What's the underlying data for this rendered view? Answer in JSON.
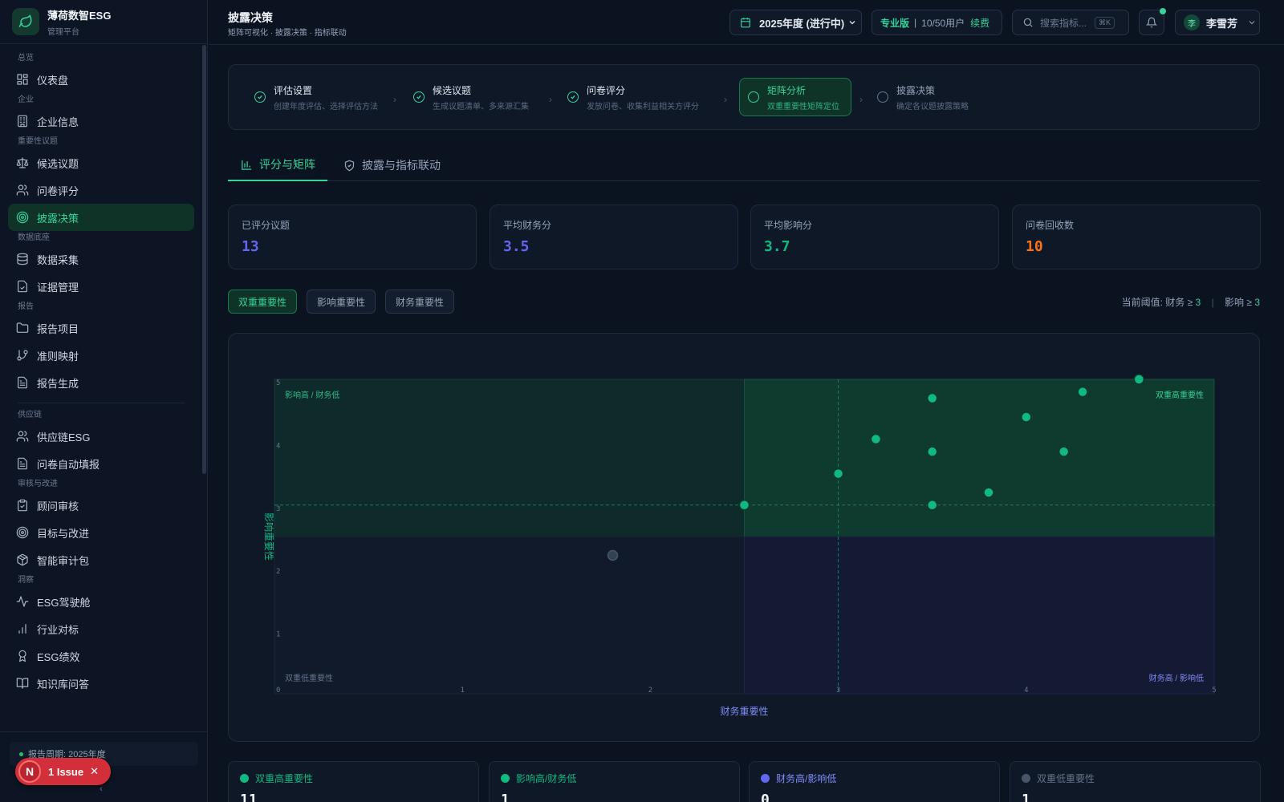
{
  "brand": {
    "name": "薄荷数智ESG",
    "sub": "管理平台"
  },
  "sidebar": {
    "groups": [
      {
        "label": "总览",
        "items": [
          {
            "label": "仪表盘",
            "icon": "grid-icon"
          }
        ]
      },
      {
        "label": "企业",
        "items": [
          {
            "label": "企业信息",
            "icon": "building-icon"
          }
        ]
      },
      {
        "label": "重要性议题",
        "items": [
          {
            "label": "候选议题",
            "icon": "scale-icon"
          },
          {
            "label": "问卷评分",
            "icon": "users-icon"
          },
          {
            "label": "披露决策",
            "icon": "target-icon",
            "active": true
          }
        ]
      },
      {
        "label": "数据底座",
        "items": [
          {
            "label": "数据采集",
            "icon": "database-icon"
          },
          {
            "label": "证据管理",
            "icon": "file-check-icon"
          }
        ]
      },
      {
        "label": "报告",
        "items": [
          {
            "label": "报告项目",
            "icon": "folder-icon"
          },
          {
            "label": "准则映射",
            "icon": "git-branch-icon"
          },
          {
            "label": "报告生成",
            "icon": "file-text-icon"
          }
        ]
      },
      {
        "label": "供应链",
        "divider": true,
        "items": [
          {
            "label": "供应链ESG",
            "icon": "users-icon"
          },
          {
            "label": "问卷自动填报",
            "icon": "file-text-icon"
          }
        ]
      },
      {
        "label": "审核与改进",
        "items": [
          {
            "label": "顾问审核",
            "icon": "clipboard-check-icon"
          },
          {
            "label": "目标与改进",
            "icon": "target-icon"
          },
          {
            "label": "智能审计包",
            "icon": "package-icon"
          }
        ]
      },
      {
        "label": "洞察",
        "items": [
          {
            "label": "ESG驾驶舱",
            "icon": "activity-icon"
          },
          {
            "label": "行业对标",
            "icon": "bar-chart-icon"
          },
          {
            "label": "ESG绩效",
            "icon": "award-icon"
          },
          {
            "label": "知识库问答",
            "icon": "book-icon"
          }
        ]
      }
    ],
    "period": "报告周期: 2025年度",
    "collapse": "‹"
  },
  "issue": {
    "letter": "N",
    "label": "1 Issue",
    "close": "✕"
  },
  "header": {
    "title": "披露决策",
    "subtitle": "矩阵可视化 · 披露决策 · 指标联动",
    "year": "2025年度 (进行中)",
    "plan": {
      "name": "专业版",
      "sep": "|",
      "users": "10/50用户",
      "renew": "续费"
    },
    "search_placeholder": "搜索指标...",
    "search_kbd": "⌘K",
    "user_avatar": "李",
    "user_name": "李雪芳"
  },
  "steps": [
    {
      "title": "评估设置",
      "desc": "创建年度评估、选择评估方法",
      "state": "done"
    },
    {
      "title": "候选议题",
      "desc": "生成议题清单、多来源汇集",
      "state": "done"
    },
    {
      "title": "问卷评分",
      "desc": "发放问卷、收集利益相关方评分",
      "state": "done"
    },
    {
      "title": "矩阵分析",
      "desc": "双重重要性矩阵定位",
      "state": "active"
    },
    {
      "title": "披露决策",
      "desc": "确定各议题披露策略",
      "state": "pending"
    }
  ],
  "tabs": [
    {
      "label": "评分与矩阵",
      "icon": "bar-chart-icon",
      "active": true
    },
    {
      "label": "披露与指标联动",
      "icon": "shield-check-icon",
      "active": false
    }
  ],
  "stats": [
    {
      "label": "已评分议题",
      "value": "13",
      "color": "#6366f1"
    },
    {
      "label": "平均财务分",
      "value": "3.5",
      "color": "#6366f1"
    },
    {
      "label": "平均影响分",
      "value": "3.7",
      "color": "#10b981"
    },
    {
      "label": "问卷回收数",
      "value": "10",
      "color": "#f97316"
    }
  ],
  "filters": [
    {
      "label": "双重重要性",
      "active": true
    },
    {
      "label": "影响重要性",
      "active": false
    },
    {
      "label": "财务重要性",
      "active": false
    }
  ],
  "threshold": {
    "prefix": "当前阈值: 财务 ≥",
    "financial": "3",
    "sep": "|",
    "impact_prefix": "影响 ≥",
    "impact": "3"
  },
  "chart_data": {
    "type": "scatter",
    "xlabel": "财务重要性",
    "ylabel": "影响重要性",
    "xlim": [
      0,
      5
    ],
    "ylim": [
      0,
      5
    ],
    "x_ticks": [
      "0",
      "1",
      "2",
      "3",
      "4",
      "5"
    ],
    "y_ticks": [
      "1",
      "2",
      "3",
      "4",
      "5"
    ],
    "threshold_x": 3,
    "threshold_y": 3,
    "quadrants": {
      "top_left": "影响高 / 财务低",
      "top_right": "双重高重要性",
      "bottom_left": "双重低重要性",
      "bottom_right": "财务高 / 影响低"
    },
    "points": [
      {
        "x": 2.5,
        "y": 3.0
      },
      {
        "x": 1.8,
        "y": 2.2
      },
      {
        "x": 3.0,
        "y": 3.5
      },
      {
        "x": 3.2,
        "y": 4.05
      },
      {
        "x": 3.5,
        "y": 4.7
      },
      {
        "x": 3.5,
        "y": 3.85
      },
      {
        "x": 3.5,
        "y": 3.0
      },
      {
        "x": 3.8,
        "y": 3.2
      },
      {
        "x": 4.0,
        "y": 4.4
      },
      {
        "x": 4.2,
        "y": 3.85
      },
      {
        "x": 4.3,
        "y": 4.8
      },
      {
        "x": 4.6,
        "y": 5.0
      }
    ],
    "colors": {
      "high": "#10b981",
      "low": "#334155"
    }
  },
  "categories": [
    {
      "label": "双重高重要性",
      "value": "11",
      "color": "#10b981"
    },
    {
      "label": "影响高/财务低",
      "value": "1",
      "color": "#10b981"
    },
    {
      "label": "财务高/影响低",
      "value": "0",
      "color": "#6366f1"
    },
    {
      "label": "双重低重要性",
      "value": "1",
      "color": "#475569"
    }
  ]
}
